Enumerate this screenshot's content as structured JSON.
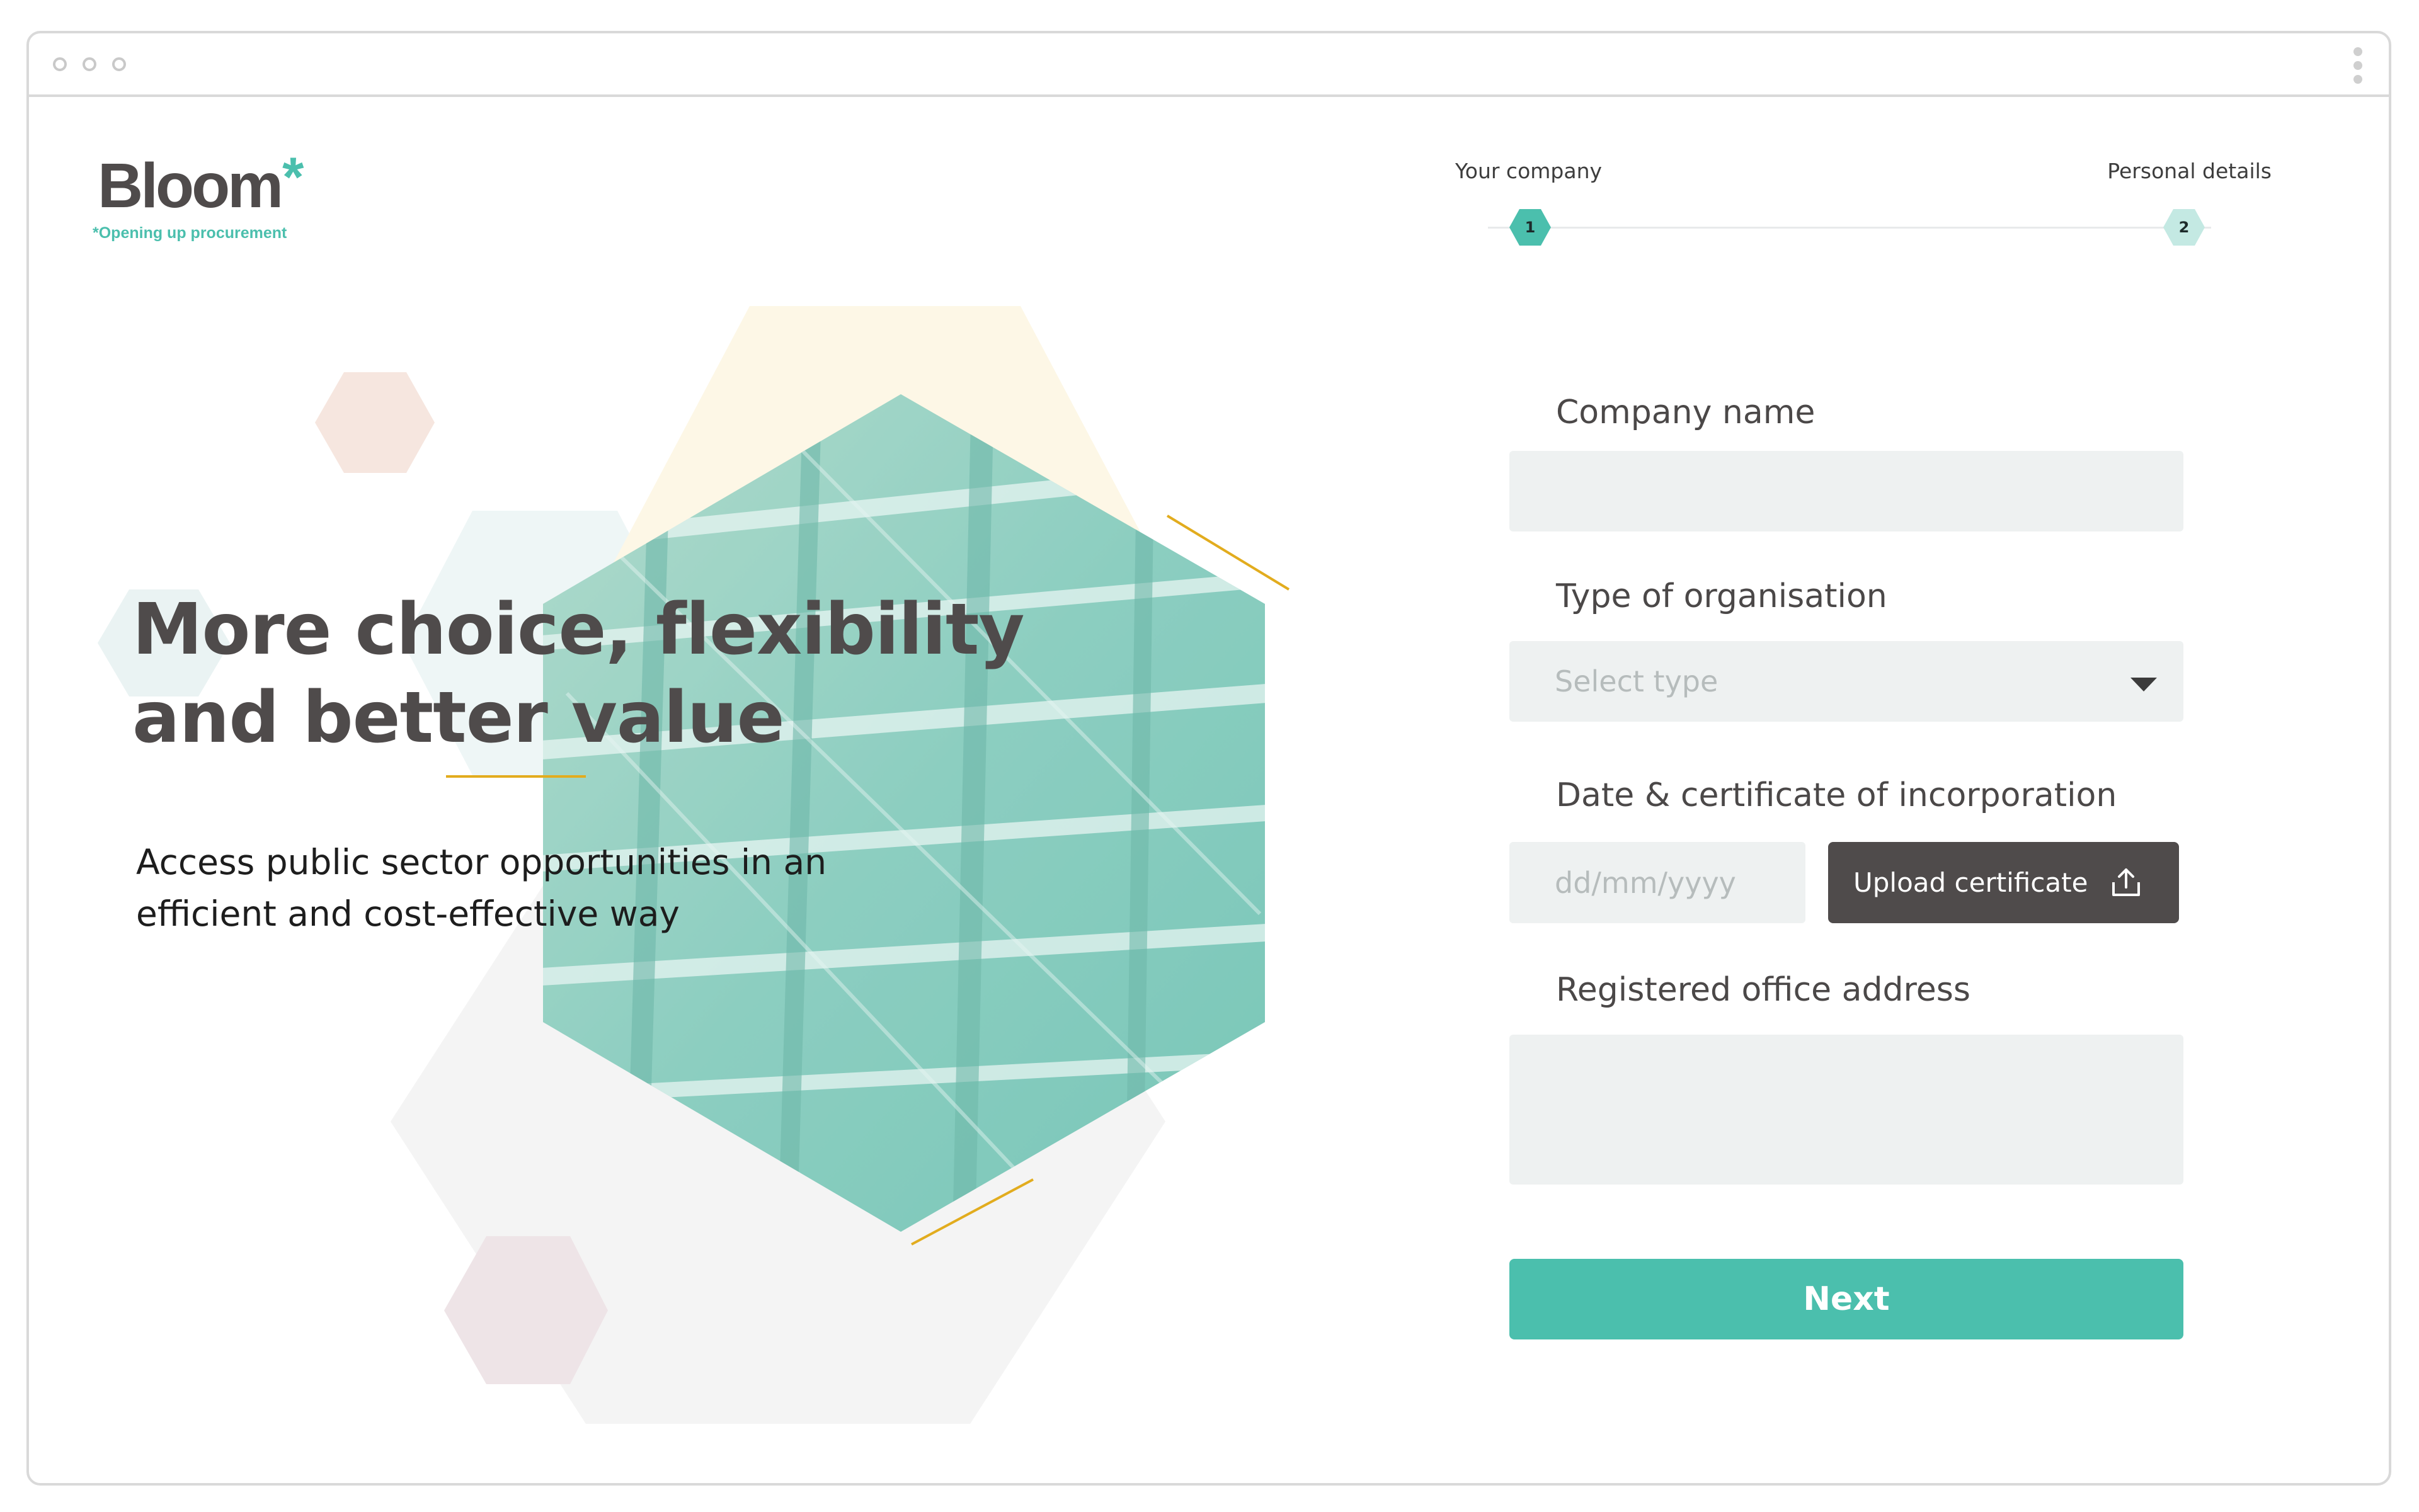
{
  "window": {
    "title_controls": [
      "window-dot",
      "window-dot",
      "window-dot"
    ]
  },
  "brand": {
    "name": "Bloom",
    "star": "*",
    "tagline": "*Opening up procurement"
  },
  "hero": {
    "headline_line1": "More choice, flexibility",
    "headline_line2": "and better value",
    "subtext_line1": "Access public sector opportunities in an",
    "subtext_line2": "efficient and cost-effective way"
  },
  "stepper": {
    "steps": [
      {
        "label": "Your company",
        "number": "1",
        "state": "active"
      },
      {
        "label": "Personal details",
        "number": "2",
        "state": "upcoming"
      }
    ]
  },
  "form": {
    "company_name": {
      "label": "Company name",
      "value": "",
      "placeholder": ""
    },
    "organisation_type": {
      "label": "Type of organisation",
      "placeholder": "Select type"
    },
    "incorporation": {
      "label": "Date & certificate of incorporation",
      "date_placeholder": "dd/mm/yyyy",
      "upload_label": "Upload certificate"
    },
    "office_address": {
      "label": "Registered office address",
      "value": ""
    },
    "next_label": "Next"
  },
  "colors": {
    "accent": "#4bbfad",
    "text_dark": "#4f4b4b",
    "input_bg": "#eef1f1",
    "highlight_line": "#e2ac1e"
  },
  "icons": {
    "upload": "upload-icon",
    "dropdown": "chevron-down-icon"
  }
}
